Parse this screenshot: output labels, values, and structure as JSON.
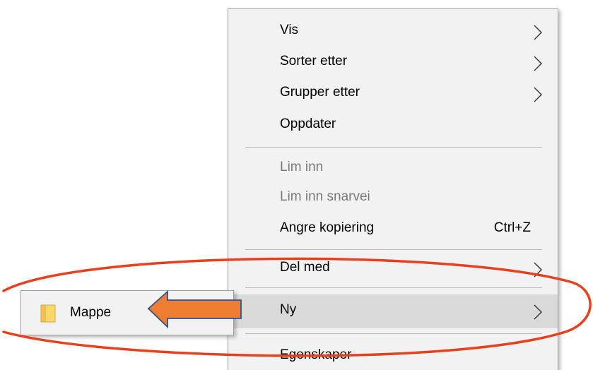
{
  "context_menu": {
    "items": [
      {
        "label": "Vis",
        "has_submenu": true
      },
      {
        "label": "Sorter etter",
        "has_submenu": true
      },
      {
        "label": "Grupper etter",
        "has_submenu": true
      },
      {
        "label": "Oppdater",
        "has_submenu": false
      },
      {
        "label": "Lim inn",
        "disabled": true
      },
      {
        "label": "Lim inn snarvei",
        "disabled": true
      },
      {
        "label": "Angre kopiering",
        "shortcut": "Ctrl+Z"
      },
      {
        "label": "Del med",
        "has_submenu": true
      },
      {
        "label": "Ny",
        "has_submenu": true,
        "highlighted": true
      },
      {
        "label": "Egenskaper",
        "has_submenu": false
      }
    ]
  },
  "submenu": {
    "items": [
      {
        "label": "Mappe",
        "icon": "folder-icon"
      }
    ]
  },
  "annotations": {
    "ellipse_color": "#e8401c",
    "arrow_fill": "#ed7d31",
    "arrow_stroke": "#2f528f"
  }
}
